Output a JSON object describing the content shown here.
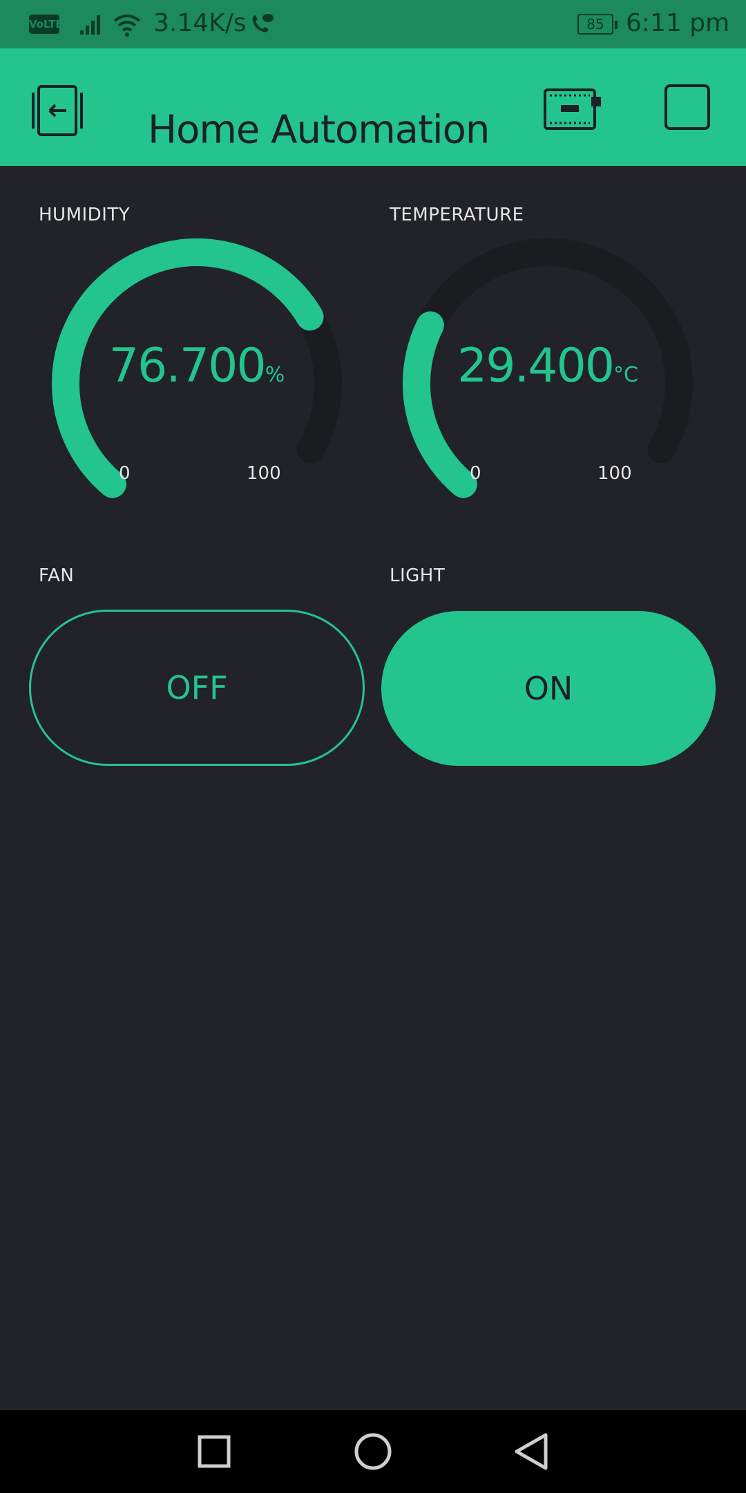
{
  "status_bar": {
    "volte": "VoLTE",
    "speed": "3.14K/s",
    "battery": "85",
    "time": "6:11 pm"
  },
  "app_bar": {
    "title": "Home Automation",
    "icons": [
      "exit-icon",
      "device-icon",
      "square-icon"
    ]
  },
  "widgets": {
    "humidity": {
      "label": "HUMIDITY",
      "value": "76.700",
      "unit": "%",
      "min": "0",
      "max": "100",
      "level": 0.767
    },
    "temperature": {
      "label": "TEMPERATURE",
      "value": "29.400",
      "unit": "°C",
      "min": "0",
      "max": "100",
      "level": 0.294
    },
    "fan": {
      "label": "FAN",
      "state": "OFF"
    },
    "light": {
      "label": "LIGHT",
      "state": "ON"
    }
  },
  "colors": {
    "accent": "#23c48e",
    "background": "#212328",
    "gauge_track": "#1a1c20",
    "status_bar": "#1c8a5e"
  },
  "nav_bar": {
    "icons": [
      "recents-icon",
      "home-icon",
      "back-icon"
    ]
  }
}
